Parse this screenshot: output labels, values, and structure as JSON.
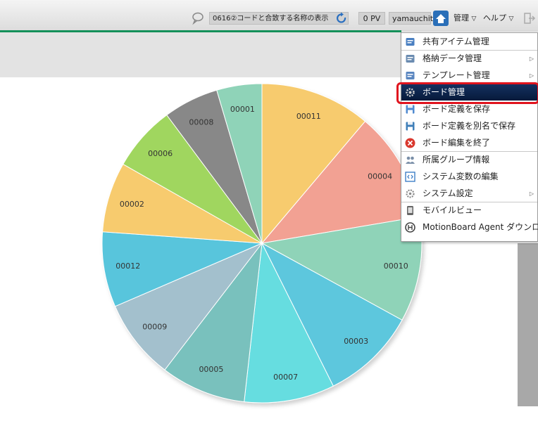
{
  "toolbar": {
    "board_name": "0616②コードと合致する名称の表示",
    "pv": "0 PV",
    "user": "yamauchit",
    "manage_label": "管理",
    "help_label": "ヘルプ"
  },
  "chart_data": {
    "type": "pie",
    "slices": [
      {
        "label": "00011",
        "value": 11.0,
        "color": "#f7cb6e"
      },
      {
        "label": "00004",
        "value": 11.0,
        "color": "#f2a193"
      },
      {
        "label": "00010",
        "value": 10.5,
        "color": "#8fd3b8"
      },
      {
        "label": "00003",
        "value": 9.5,
        "color": "#5dc7dd"
      },
      {
        "label": "00007",
        "value": 9.0,
        "color": "#66dde0"
      },
      {
        "label": "00005",
        "value": 8.5,
        "color": "#79c1bd"
      },
      {
        "label": "00009",
        "value": 8.0,
        "color": "#a3c0cd"
      },
      {
        "label": "00012",
        "value": 7.5,
        "color": "#59c5dc"
      },
      {
        "label": "00002",
        "value": 7.0,
        "color": "#f7cb6e"
      },
      {
        "label": "00006",
        "value": 6.5,
        "color": "#a0d65e"
      },
      {
        "label": "00008",
        "value": 5.5,
        "color": "#888888"
      },
      {
        "label": "00001",
        "value": 4.5,
        "color": "#8fd3b8"
      }
    ]
  },
  "menu": {
    "items": [
      {
        "label": "共有アイテム管理",
        "icon": "shared-items-icon",
        "submenu": false,
        "color": "#4a7fc1"
      },
      {
        "label": "格納データ管理",
        "icon": "stored-data-icon",
        "submenu": true,
        "color": "#6a8bb0"
      },
      {
        "label": "テンプレート管理",
        "icon": "template-icon",
        "submenu": true,
        "color": "#5a86c0"
      },
      {
        "label": "ボード管理",
        "icon": "gear-icon",
        "submenu": false,
        "selected": true,
        "color": "#cccccc"
      },
      {
        "label": "ボード定義を保存",
        "icon": "save-icon",
        "submenu": false,
        "color": "#4f8ad0"
      },
      {
        "label": "ボード定義を別名で保存",
        "icon": "save-as-icon",
        "submenu": false,
        "color": "#3f7fb8"
      },
      {
        "label": "ボード編集を終了",
        "icon": "close-icon",
        "submenu": false,
        "color": "#d9382e"
      },
      {
        "label": "所属グループ情報",
        "icon": "group-icon",
        "submenu": false,
        "color": "#7a8fa8"
      },
      {
        "label": "システム変数の編集",
        "icon": "variable-icon",
        "submenu": false,
        "color": "#3f7fc8"
      },
      {
        "label": "システム設定",
        "icon": "settings-icon",
        "submenu": true,
        "color": "#8a8a8a"
      },
      {
        "label": "モバイルビュー",
        "icon": "mobile-icon",
        "submenu": false,
        "color": "#666666"
      },
      {
        "label": "MotionBoard Agent ダウンロード",
        "icon": "agent-download-icon",
        "submenu": false,
        "color": "#444444"
      }
    ]
  }
}
